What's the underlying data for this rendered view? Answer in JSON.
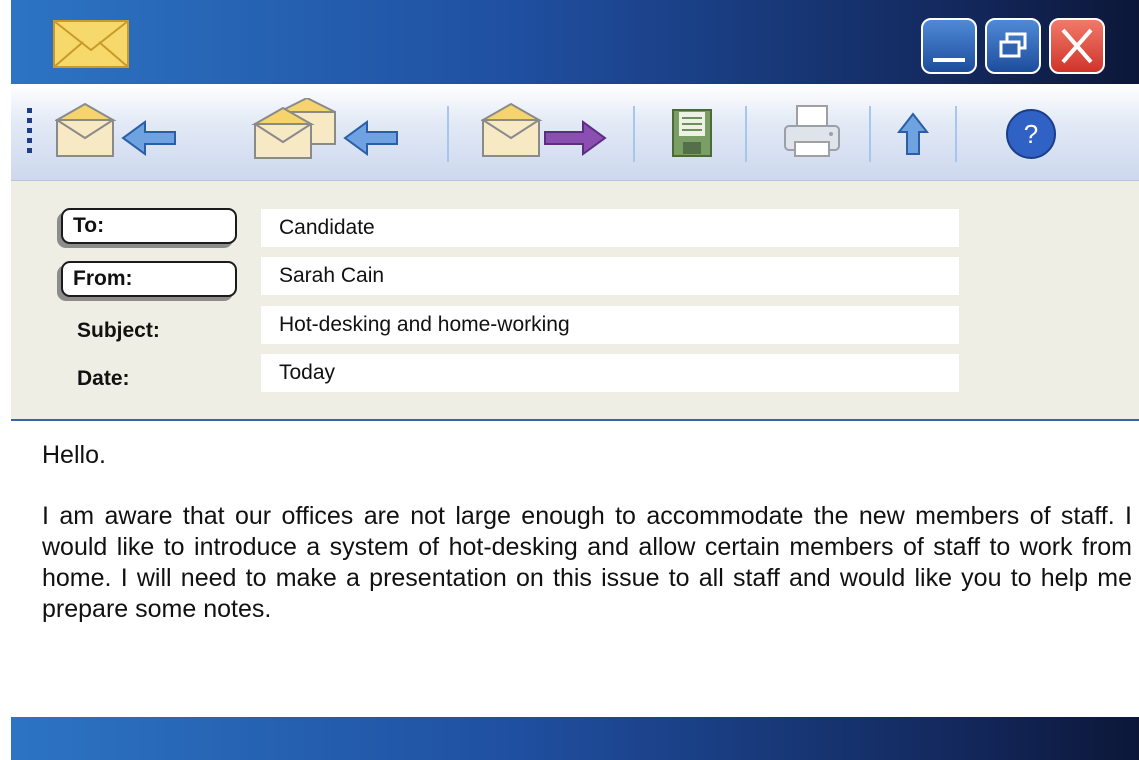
{
  "titlebar": {
    "icon": "envelope-icon",
    "buttons": [
      {
        "name": "minimize",
        "icon": "minimize-icon"
      },
      {
        "name": "restore",
        "icon": "restore-icon"
      },
      {
        "name": "close",
        "icon": "close-icon"
      }
    ]
  },
  "toolbar": {
    "tools": [
      {
        "name": "reply",
        "icon": "reply-icon"
      },
      {
        "name": "reply-all",
        "icon": "reply-all-icon"
      },
      {
        "name": "forward",
        "icon": "forward-icon"
      },
      {
        "name": "save",
        "icon": "save-icon"
      },
      {
        "name": "print",
        "icon": "print-icon"
      },
      {
        "name": "send",
        "icon": "up-arrow-icon"
      },
      {
        "name": "help",
        "icon": "help-icon",
        "label": "?"
      }
    ]
  },
  "header": {
    "to_label": "To:",
    "to_value": "Candidate",
    "from_label": "From:",
    "from_value": "Sarah Cain",
    "subject_label": "Subject:",
    "subject_value": "Hot-desking and home-working",
    "date_label": "Date:",
    "date_value": "Today"
  },
  "message": {
    "greeting": "Hello.",
    "body": "I am aware that our offices are not large enough to accommodate the new members of staff. I would like to introduce a system of hot-desking and allow certain members of staff to work from home. I will need to make a presentation on this issue to all staff and would like you to help me prepare some notes."
  },
  "colors": {
    "titlebar_start": "#2d74c4",
    "titlebar_end": "#0c1738",
    "close_button": "#e04a3a",
    "header_bg": "#efeee4",
    "header_border": "#3b63a8"
  }
}
